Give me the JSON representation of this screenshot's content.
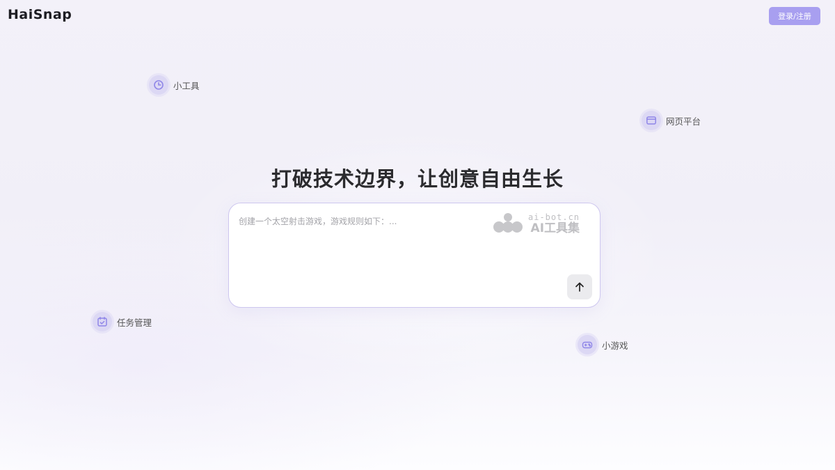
{
  "header": {
    "logo_text": "HaiSnap",
    "login_label": "登录/注册"
  },
  "chips": [
    {
      "label": "小工具",
      "icon": "clock-icon"
    },
    {
      "label": "网页平台",
      "icon": "browser-window-icon"
    },
    {
      "label": "任务管理",
      "icon": "calendar-check-icon"
    },
    {
      "label": "小游戏",
      "icon": "gamepad-icon"
    }
  ],
  "hero": {
    "headline": "打破技术边界，让创意自由生长"
  },
  "prompt": {
    "placeholder": "创建一个太空射击游戏，游戏规则如下：...",
    "value": "",
    "send_icon": "arrow-up-icon"
  },
  "watermark": {
    "url": "ai-bot.cn",
    "name": "AI工具集",
    "icon": "ai-bot-logo-icon"
  },
  "colors": {
    "accent": "#a89ff0",
    "chip_bg": "#dcd8f4",
    "icon_stroke": "#8f86e8",
    "box_border": "#cdc6ef"
  }
}
